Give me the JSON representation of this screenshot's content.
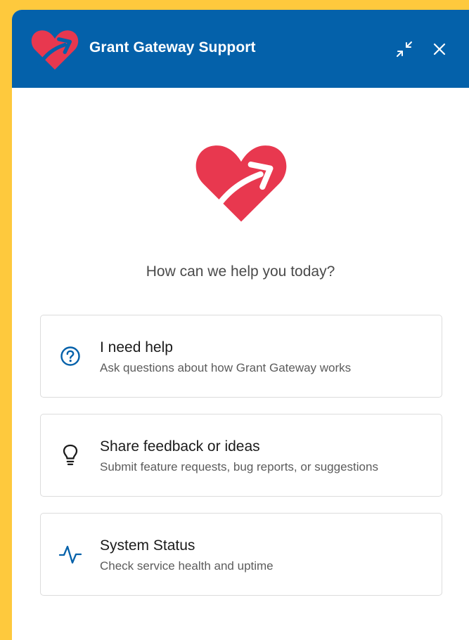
{
  "header": {
    "title": "Grant Gateway Support",
    "logo_icon": "heart-arrow-icon",
    "minimize_icon": "minimize-icon",
    "close_icon": "close-icon",
    "background_color": "#0461aa"
  },
  "hero": {
    "logo_icon": "heart-arrow-icon",
    "greeting": "How can we help you today?"
  },
  "options": [
    {
      "title": "I need help",
      "description": "Ask questions about how Grant Gateway works",
      "icon": "question-circle-icon",
      "icon_color": "#0461aa"
    },
    {
      "title": "Share feedback or ideas",
      "description": "Submit feature requests, bug reports, or suggestions",
      "icon": "lightbulb-icon",
      "icon_color": "#1b1b1b"
    },
    {
      "title": "System Status",
      "description": "Check service health and uptime",
      "icon": "pulse-icon",
      "icon_color": "#0461aa"
    }
  ],
  "colors": {
    "brand_red": "#e8384f",
    "page_background": "#fec93d"
  }
}
